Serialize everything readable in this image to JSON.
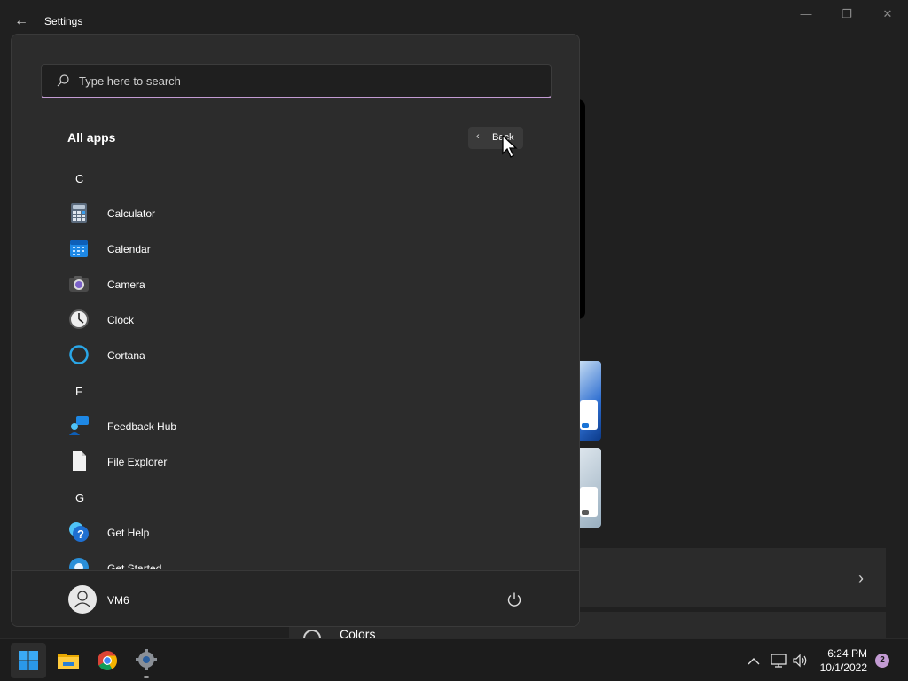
{
  "window": {
    "title": "Settings",
    "back_icon": "back-arrow-icon",
    "controls": [
      "minimize-icon",
      "maximize-icon",
      "close-icon"
    ]
  },
  "background": {
    "colors_label": "Colors"
  },
  "start_menu": {
    "search": {
      "placeholder": "Type here to search",
      "value": ""
    },
    "title": "All apps",
    "back_button_label": "Back",
    "sections": [
      {
        "letter": "C",
        "apps": [
          {
            "label": "Calculator",
            "icon": "calculator-icon"
          },
          {
            "label": "Calendar",
            "icon": "calendar-icon"
          },
          {
            "label": "Camera",
            "icon": "camera-icon"
          },
          {
            "label": "Clock",
            "icon": "clock-icon"
          },
          {
            "label": "Cortana",
            "icon": "cortana-icon"
          }
        ]
      },
      {
        "letter": "F",
        "apps": [
          {
            "label": "Feedback Hub",
            "icon": "feedback-hub-icon"
          },
          {
            "label": "File Explorer",
            "icon": "file-explorer-icon"
          }
        ]
      },
      {
        "letter": "G",
        "apps": [
          {
            "label": "Get Help",
            "icon": "get-help-icon"
          },
          {
            "label": "Get Started",
            "icon": "get-started-icon"
          }
        ]
      }
    ],
    "user": {
      "name": "VM6"
    }
  },
  "taskbar": {
    "pinned": [
      "start-icon",
      "file-explorer-icon",
      "chrome-icon",
      "settings-icon"
    ],
    "clock": {
      "time": "6:24 PM",
      "date": "10/1/2022"
    },
    "notification_count": "2",
    "accent_color": "#c39bd3"
  }
}
